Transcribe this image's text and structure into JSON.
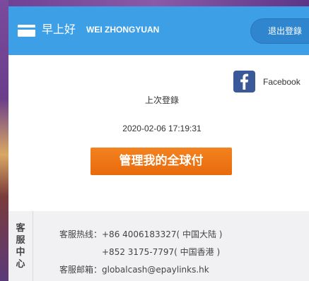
{
  "header": {
    "greeting": "早上好",
    "username": "WEI ZHONGYUAN",
    "logout_label": "退出登錄",
    "accent_color": "#3d9fe6"
  },
  "social": {
    "facebook_label": "Facebook",
    "facebook_icon": "facebook-icon"
  },
  "login": {
    "last_login_label": "上次登錄",
    "last_login_time": "2020-02-06 17:19:31"
  },
  "main": {
    "manage_button_label": "管理我的全球付",
    "button_color": "#ee7414"
  },
  "service_center": {
    "title_chars": [
      "客",
      "服",
      "中",
      "心"
    ],
    "hotline_label": "客服热线：",
    "hotline_mainland": "+86 4006183327( 中国大陆 )",
    "hotline_hk": "+852 3175-7797( 中国香港 )",
    "email_label": "客服邮箱：",
    "email": "globalcash@epaylinks.hk"
  }
}
